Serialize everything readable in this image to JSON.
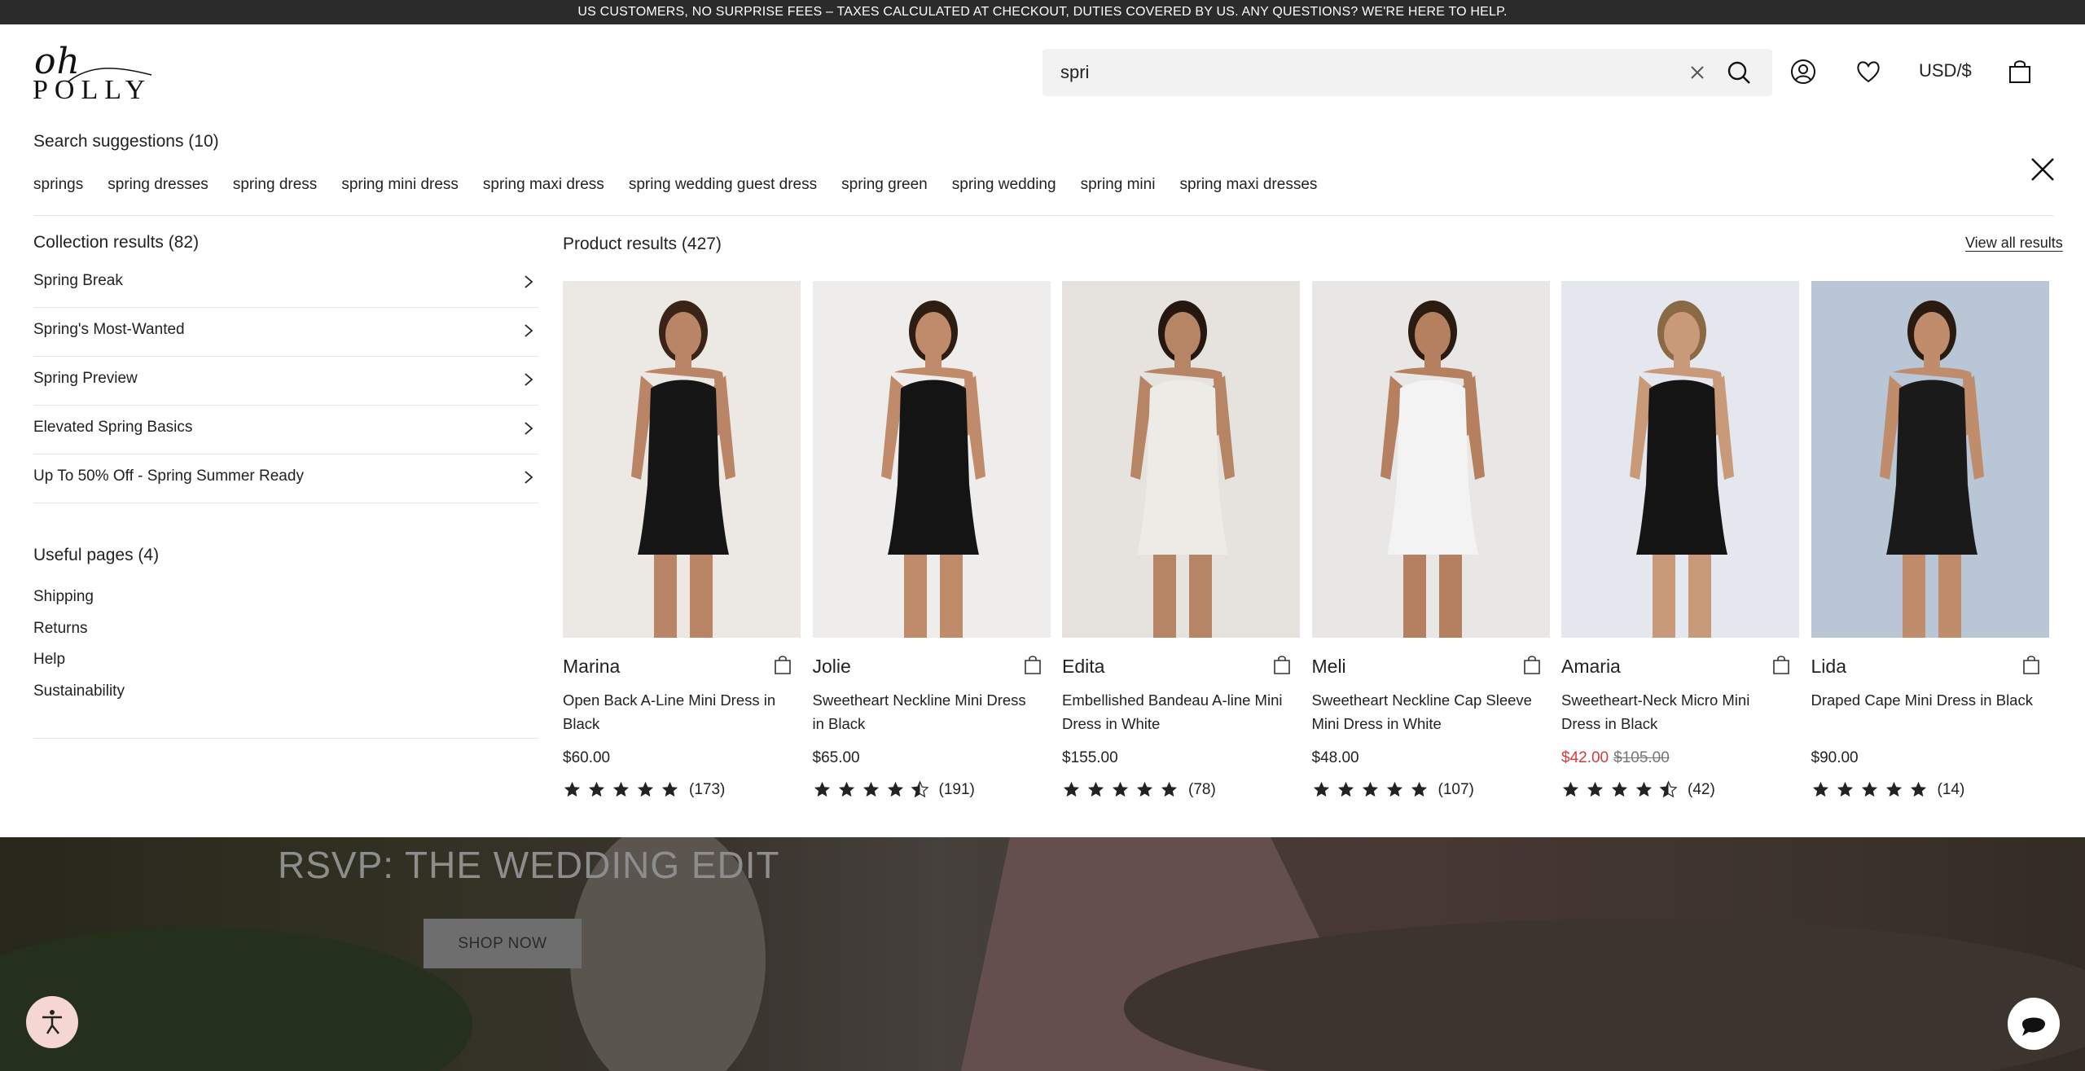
{
  "announcement": "US CUSTOMERS, NO SURPRISE FEES – TAXES CALCULATED AT CHECKOUT, DUTIES COVERED BY US. ANY QUESTIONS? WE'RE HERE TO HELP.",
  "brand": {
    "line1": "oh",
    "line2": "POLLY"
  },
  "search": {
    "value": "spri"
  },
  "header": {
    "currency": "USD/$"
  },
  "suggestions": {
    "title": "Search suggestions (10)",
    "items": [
      "springs",
      "spring dresses",
      "spring dress",
      "spring mini dress",
      "spring maxi dress",
      "spring wedding guest dress",
      "spring green",
      "spring wedding",
      "spring mini",
      "spring maxi dresses"
    ]
  },
  "collections": {
    "title": "Collection results (82)",
    "items": [
      "Spring Break",
      "Spring's Most-Wanted",
      "Spring Preview",
      "Elevated Spring Basics",
      "Up To 50% Off - Spring Summer Ready"
    ]
  },
  "useful_pages": {
    "title": "Useful pages (4)",
    "items": [
      "Shipping",
      "Returns",
      "Help",
      "Sustainability"
    ]
  },
  "products": {
    "title": "Product results (427)",
    "view_all": "View all results",
    "items": [
      {
        "name": "Marina",
        "desc": "Open Back A-Line Mini Dress in Black",
        "price": "$60.00",
        "sale_price": "",
        "orig_price": "",
        "reviews": "(173)",
        "rating": 5,
        "dress_color": "#161616",
        "bg": "#ece8e4",
        "skin": "#b98566",
        "hair": "#3a2418"
      },
      {
        "name": "Jolie",
        "desc": "Sweetheart Neckline Mini Dress in Black",
        "price": "$65.00",
        "sale_price": "",
        "orig_price": "",
        "reviews": "(191)",
        "rating": 4.5,
        "dress_color": "#141414",
        "bg": "#efedeb",
        "skin": "#c08b6b",
        "hair": "#2e1d12"
      },
      {
        "name": "Edita",
        "desc": "Embellished Bandeau A-line Mini Dress in White",
        "price": "$155.00",
        "sale_price": "",
        "orig_price": "",
        "reviews": "(78)",
        "rating": 5,
        "dress_color": "#ecebe6",
        "bg": "#e6e3df",
        "skin": "#b58566",
        "hair": "#261810"
      },
      {
        "name": "Meli",
        "desc": "Sweetheart Neckline Cap Sleeve Mini Dress in White",
        "price": "$48.00",
        "sale_price": "",
        "orig_price": "",
        "reviews": "(107)",
        "rating": 5,
        "dress_color": "#f3f3f3",
        "bg": "#e9e7e5",
        "skin": "#b4805f",
        "hair": "#2b1c12"
      },
      {
        "name": "Amaria",
        "desc": "Sweetheart-Neck Micro Mini Dress in Black",
        "price": "",
        "sale_price": "$42.00",
        "orig_price": "$105.00",
        "reviews": "(42)",
        "rating": 4.5,
        "dress_color": "#141414",
        "bg": "#e4e8ee",
        "skin": "#c89a7a",
        "hair": "#8a6a44"
      },
      {
        "name": "Lida",
        "desc": "Draped Cape Mini Dress in Black",
        "price": "$90.00",
        "sale_price": "",
        "orig_price": "",
        "reviews": "(14)",
        "rating": 5,
        "dress_color": "#1a1a1a",
        "bg": "#b9c6d6",
        "skin": "#bf8d6c",
        "hair": "#2a1b10"
      }
    ]
  },
  "hero": {
    "headline": "RSVP: THE WEDDING EDIT",
    "cta": "SHOP NOW"
  }
}
